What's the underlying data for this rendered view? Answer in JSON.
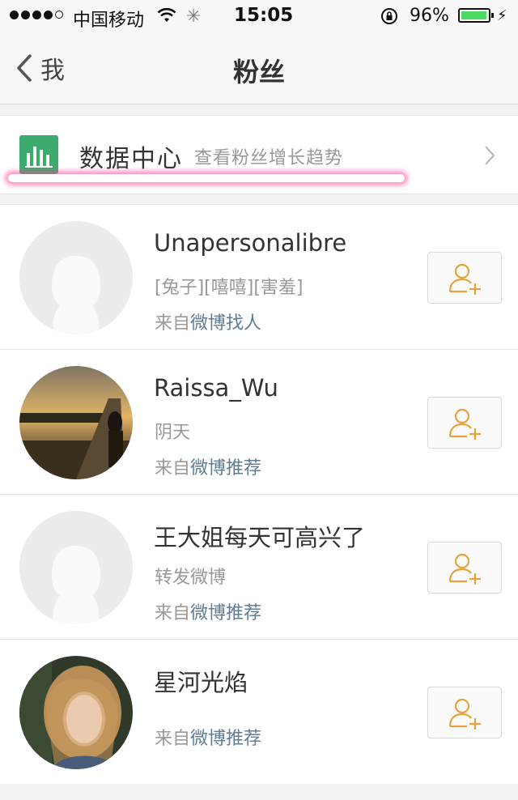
{
  "status_bar": {
    "carrier": "中国移动",
    "time": "15:05",
    "battery": "96%",
    "battery_level": 0.96,
    "icons": [
      "signal-dots",
      "wifi-icon",
      "spinner-icon",
      "rotation-lock-icon",
      "battery-icon",
      "charging-icon"
    ]
  },
  "nav": {
    "back_label": "我",
    "title": "粉丝"
  },
  "data_center": {
    "title": "数据中心",
    "subtitle": "查看粉丝增长趋势",
    "icon": "bar-chart-icon"
  },
  "fans": [
    {
      "name": "Unapersonalibre",
      "intro": "[兔子][嘻嘻][害羞]",
      "source_prefix": "来自",
      "source_link": "微博找人",
      "avatar": "default-avatar"
    },
    {
      "name": "Raissa_Wu",
      "intro": "阴天",
      "source_prefix": "来自",
      "source_link": "微博推荐",
      "avatar": "sunset-photo-avatar"
    },
    {
      "name": "王大姐每天可高兴了",
      "intro": "转发微博",
      "source_prefix": "来自",
      "source_link": "微博推荐",
      "avatar": "default-avatar"
    },
    {
      "name": "星河光焰",
      "source_prefix": "来自",
      "source_link": "微博推荐",
      "avatar": "portrait-photo-avatar"
    }
  ],
  "colors": {
    "accent_orange": "#e8a23a",
    "chart_green": "#3daa6e",
    "link_blue": "#5f7d95",
    "battery_green": "#4cd964",
    "highlight_pink": "#ff3c96"
  }
}
